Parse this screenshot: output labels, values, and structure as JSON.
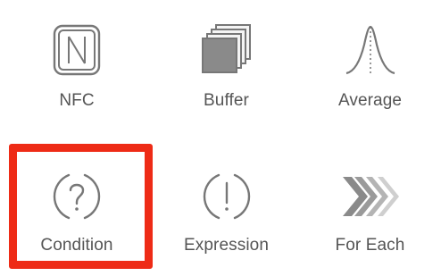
{
  "palette": {
    "label": "#555555",
    "icon": "#777777",
    "divider": "#e6e6e6",
    "highlight": "#ee2b16"
  },
  "tiles": [
    {
      "id": "nfc",
      "label": "NFC",
      "icon": "nfc-icon"
    },
    {
      "id": "buffer",
      "label": "Buffer",
      "icon": "buffer-icon"
    },
    {
      "id": "average",
      "label": "Average",
      "icon": "bell-curve-icon"
    },
    {
      "id": "condition",
      "label": "Condition",
      "icon": "question-circle-icon",
      "highlighted": true
    },
    {
      "id": "expression",
      "label": "Expression",
      "icon": "exclamation-circle-icon"
    },
    {
      "id": "for-each",
      "label": "For Each",
      "icon": "chevrons-right-icon"
    }
  ]
}
